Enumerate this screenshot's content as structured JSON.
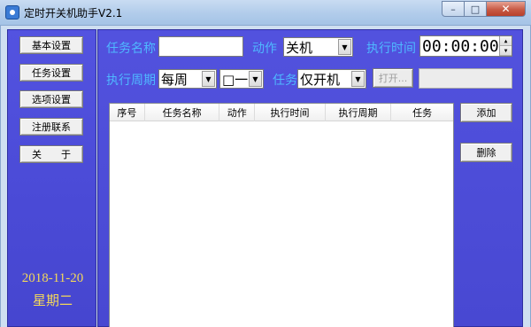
{
  "window": {
    "title": "定时开关机助手V2.1",
    "controls": {
      "minimize": "–",
      "maximize": "□",
      "close": "✕"
    }
  },
  "sidebar": {
    "buttons": [
      "基本设置",
      "任务设置",
      "选项设置",
      "注册联系",
      "关　　于"
    ],
    "date": "2018-11-20",
    "weekday": "星期二"
  },
  "form": {
    "task_name_label": "任务名称",
    "task_name_value": "",
    "action_label": "动作",
    "action_value": "关机",
    "exec_time_label": "执行时间",
    "exec_time_value": "00:00:00",
    "cycle_label": "执行周期",
    "cycle_value": "每周",
    "weekday_value": "□一",
    "task_label": "任务",
    "task_value": "仅开机",
    "open_button": "打开...",
    "path_value": ""
  },
  "list": {
    "columns": [
      "序号",
      "任务名称",
      "动作",
      "执行时间",
      "执行周期",
      "任务"
    ],
    "rows": []
  },
  "actions": {
    "add": "添加",
    "delete": "删除"
  },
  "colors": {
    "panel": "#4b4bd5",
    "label": "#4fb8ff",
    "date": "#f3d85a"
  }
}
